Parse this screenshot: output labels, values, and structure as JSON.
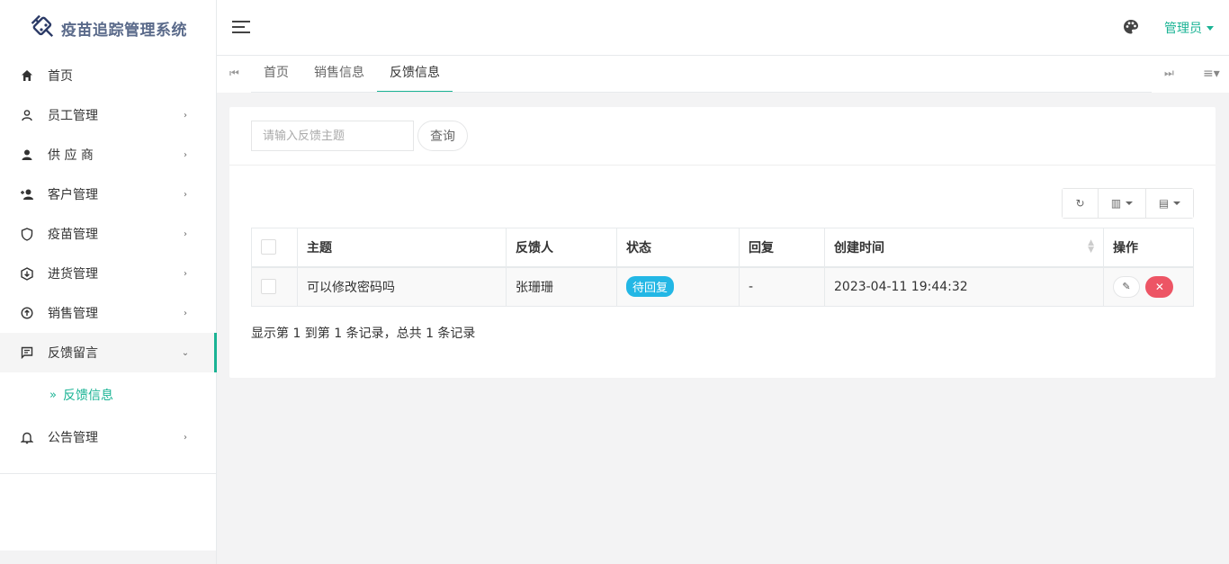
{
  "app": {
    "title": "疫苗追踪管理系统"
  },
  "sidebar": {
    "items": [
      {
        "label": "首页",
        "icon": "home-icon"
      },
      {
        "label": "员工管理",
        "icon": "person-outline-icon"
      },
      {
        "label": "供 应 商",
        "icon": "person-icon"
      },
      {
        "label": "客户管理",
        "icon": "person-add-icon"
      },
      {
        "label": "疫苗管理",
        "icon": "shield-icon"
      },
      {
        "label": "进货管理",
        "icon": "download-icon"
      },
      {
        "label": "销售管理",
        "icon": "upload-icon"
      },
      {
        "label": "反馈留言",
        "icon": "message-icon"
      },
      {
        "label": "公告管理",
        "icon": "bell-icon"
      }
    ],
    "sub_item": {
      "label": "反馈信息"
    }
  },
  "header": {
    "user": "管理员"
  },
  "tabs": [
    {
      "label": "首页"
    },
    {
      "label": "销售信息"
    },
    {
      "label": "反馈信息"
    }
  ],
  "search": {
    "placeholder": "请输入反馈主题",
    "button": "查询"
  },
  "table": {
    "columns": [
      "主题",
      "反馈人",
      "状态",
      "回复",
      "创建时间",
      "操作"
    ],
    "rows": [
      {
        "subject": "可以修改密码吗",
        "user": "张珊珊",
        "status": "待回复",
        "reply": "-",
        "created": "2023-04-11 19:44:32"
      }
    ]
  },
  "pager": {
    "info": "显示第 1 到第 1 条记录，总共 1 条记录"
  },
  "colors": {
    "accent": "#1ab394",
    "badge": "#23b7e5",
    "danger": "#ed5565"
  }
}
